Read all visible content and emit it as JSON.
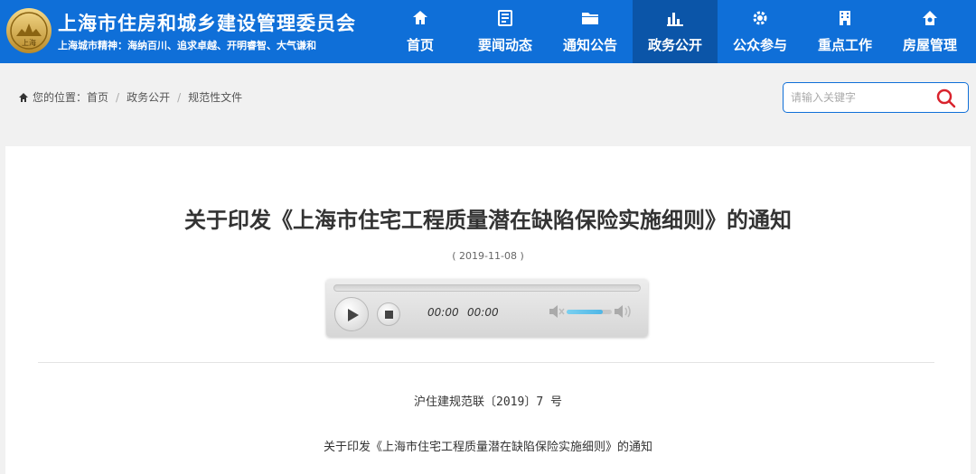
{
  "header": {
    "site_title": "上海市住房和城乡建设管理委员会",
    "slogan": "上海城市精神：海纳百川、追求卓越、开明睿智、大气谦和",
    "logo_text": "上海",
    "nav": [
      {
        "label": "首页",
        "icon": "home-icon"
      },
      {
        "label": "要闻动态",
        "icon": "news-icon"
      },
      {
        "label": "通知公告",
        "icon": "folder-icon"
      },
      {
        "label": "政务公开",
        "icon": "bar-chart-icon",
        "active": true
      },
      {
        "label": "公众参与",
        "icon": "gear-icon"
      },
      {
        "label": "重点工作",
        "icon": "building-icon"
      },
      {
        "label": "房屋管理",
        "icon": "house-key-icon"
      }
    ],
    "colors": {
      "primary": "#0f6fd8",
      "active": "#0b55a8"
    }
  },
  "breadcrumb": {
    "prefix": "您的位置：",
    "items": [
      "首页",
      "政务公开",
      "规范性文件"
    ]
  },
  "search": {
    "placeholder": "请输入关键字",
    "accent": "#d9232d"
  },
  "article": {
    "title": "关于印发《上海市住宅工程质量潜在缺陷保险实施细则》的通知",
    "date": "( 2019-11-08 )",
    "doc_number": "沪住建规范联〔2019〕7 号",
    "subtitle": "关于印发《上海市住宅工程质量潜在缺陷保险实施细则》的通知"
  },
  "player": {
    "current_time": "00:00",
    "total_time": "00:00",
    "progress": 0,
    "volume": 0.8
  }
}
